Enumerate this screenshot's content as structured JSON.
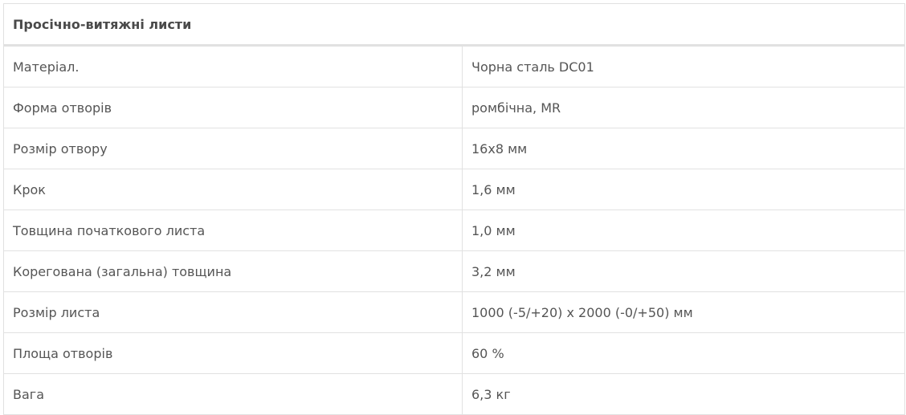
{
  "table": {
    "title": "Просічно-витяжні листи",
    "rows": [
      {
        "label": "Матеріал.",
        "value": "Чорна сталь DC01"
      },
      {
        "label": "Форма отворів",
        "value": "ромбічна, MR"
      },
      {
        "label": "Розмір отвору",
        "value": "16x8 мм"
      },
      {
        "label": "Крок",
        "value": "1,6 мм"
      },
      {
        "label": "Товщина початкового листа",
        "value": "1,0 мм"
      },
      {
        "label": "Корегована (загальна) товщина",
        "value": "3,2 мм"
      },
      {
        "label": "Розмір листа",
        "value": "1000 (-5/+20) x 2000 (-0/+50) мм"
      },
      {
        "label": "Площа отворів",
        "value": "60 %"
      },
      {
        "label": "Вага",
        "value": "6,3 кг"
      }
    ]
  }
}
